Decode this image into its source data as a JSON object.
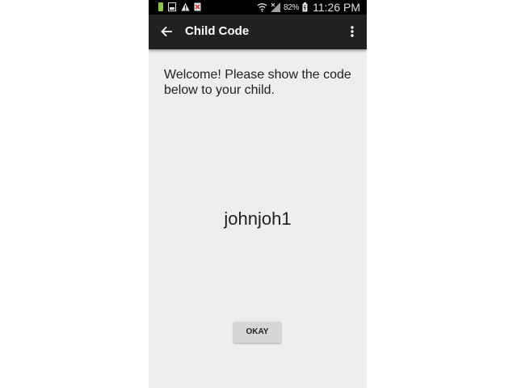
{
  "status_bar": {
    "battery_percent": "82%",
    "time": "11:26 PM"
  },
  "app_bar": {
    "title": "Child Code"
  },
  "main": {
    "welcome_text": "Welcome! Please show the code below to your child.",
    "child_code": "johnjoh1",
    "okay_label": "OKAY"
  },
  "colors": {
    "app_bar": "#212121",
    "background": "#eeeeee",
    "button": "#d6d6d6"
  }
}
